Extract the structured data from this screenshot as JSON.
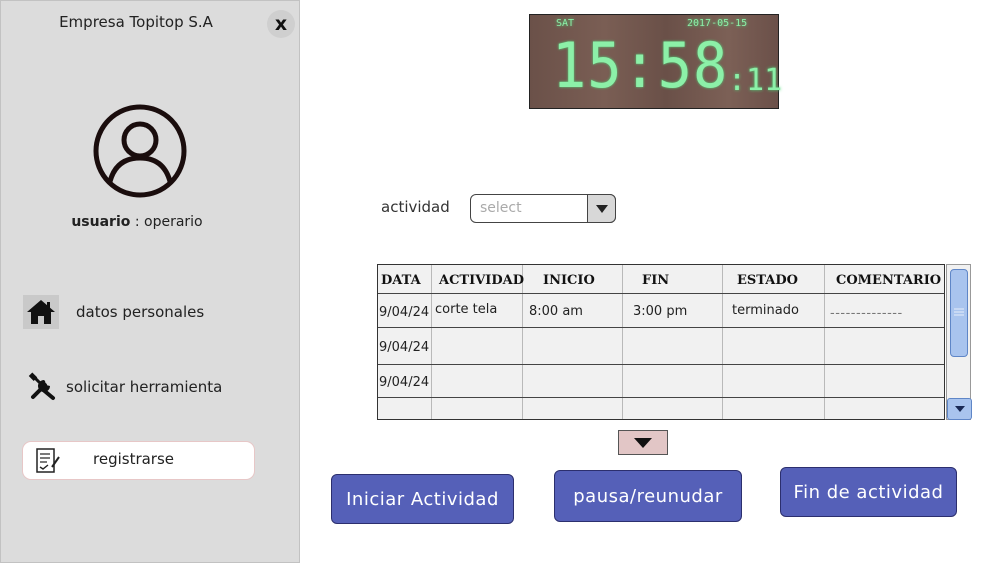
{
  "sidebar": {
    "company": "Empresa Topitop S.A",
    "close_label": "x",
    "user_role_label": "usuario",
    "user_role_sep": " : ",
    "user_role_value": "operario",
    "items": [
      {
        "label": "datos personales",
        "icon": "home-icon"
      },
      {
        "label": "solicitar herramienta",
        "icon": "tools-icon"
      },
      {
        "label": "registrarse",
        "icon": "form-check-icon"
      }
    ]
  },
  "clock": {
    "day": "SAT",
    "date": "2017-05-15",
    "time": "15:58",
    "seconds": ":11"
  },
  "activity": {
    "label": "actividad",
    "placeholder": "select"
  },
  "table": {
    "headers": [
      "DATA",
      "ACTIVIDAD",
      "INICIO",
      "FIN",
      "ESTADO",
      "COMENTARIO"
    ],
    "rows": [
      [
        "9/04/24",
        "corte tela",
        "8:00 am",
        "3:00 pm",
        "terminado",
        "--------------"
      ],
      [
        "9/04/24",
        "",
        "",
        "",
        "",
        ""
      ],
      [
        "9/04/24",
        "",
        "",
        "",
        "",
        ""
      ],
      [
        "",
        "",
        "",
        "",
        "",
        ""
      ]
    ]
  },
  "buttons": {
    "start": "Iniciar Actividad",
    "pause": "pausa/reunudar",
    "end": "Fin de actividad"
  },
  "colors": {
    "sidebar_bg": "#dcdcdc",
    "button_bg": "#5560b8",
    "clock_digits": "#8cf0a8",
    "scroll_accent": "#a9c4ee"
  }
}
